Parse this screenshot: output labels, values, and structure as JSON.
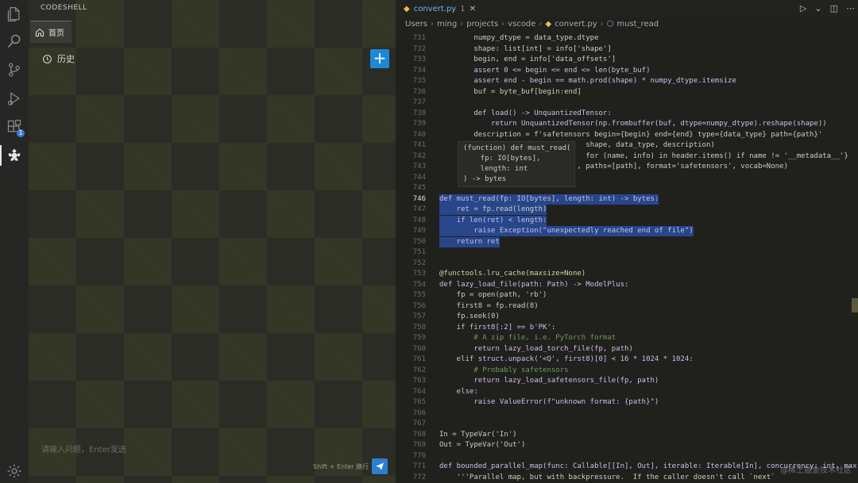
{
  "sidebar_panel": {
    "title": "CODESHELL",
    "home_tab": "首页",
    "history_label": "历史",
    "input_placeholder": "请输入问题，Enter发送",
    "send_hint": "Shift + Enter 换行"
  },
  "activity_bar": {
    "icons": [
      "files-icon",
      "search-icon",
      "source-control-icon",
      "run-debug-icon",
      "extensions-icon",
      "codeshell-icon",
      "gear-icon"
    ],
    "extensions_badge": "1"
  },
  "editor": {
    "tab_name": "convert.py",
    "tab_dirty": "1",
    "breadcrumb": [
      "Users",
      "ming",
      "projects",
      "vscode",
      "convert.py",
      "must_read"
    ],
    "hover_lines": [
      "(function) def must_read(",
      "    fp: IO[bytes],",
      "    length: int",
      ") -> bytes"
    ],
    "lines": [
      {
        "n": "731",
        "t": "        numpy_dtype = data_type.dtype"
      },
      {
        "n": "732",
        "t": "        shape: list[int] = info['shape']"
      },
      {
        "n": "733",
        "t": "        begin, end = info['data_offsets']"
      },
      {
        "n": "734",
        "t": "        assert 0 <= begin <= end <= len(byte_buf)"
      },
      {
        "n": "735",
        "t": "        assert end - begin == math.prod(shape) * numpy_dtype.itemsize"
      },
      {
        "n": "736",
        "t": "        buf = byte_buf[begin:end]"
      },
      {
        "n": "737",
        "t": ""
      },
      {
        "n": "738",
        "t": "        def load() -> UnquantizedTensor:"
      },
      {
        "n": "739",
        "t": "            return UnquantizedTensor(np.frombuffer(buf, dtype=numpy_dtype).reshape(shape))"
      },
      {
        "n": "740",
        "t": "        description = f'safetensors begin={begin} end={end} type={data_type} path={path}'"
      },
      {
        "n": "741",
        "t": "                                  shape, data_type, description)"
      },
      {
        "n": "742",
        "t": "                                  for (name, info) in header.items() if name != '__metadata__'}"
      },
      {
        "n": "743",
        "t": "                                , paths=[path], format='safetensors', vocab=None)"
      },
      {
        "n": "744",
        "t": ""
      },
      {
        "n": "745",
        "t": ""
      },
      {
        "n": "746",
        "t": "def must_read(fp: IO[bytes], length: int) -> bytes:"
      },
      {
        "n": "747",
        "t": "    ret = fp.read(length)"
      },
      {
        "n": "748",
        "t": "    if len(ret) < length:"
      },
      {
        "n": "749",
        "t": "        raise Exception(\"unexpectedly reached end of file\")"
      },
      {
        "n": "750",
        "t": "    return ret"
      },
      {
        "n": "751",
        "t": ""
      },
      {
        "n": "752",
        "t": ""
      },
      {
        "n": "753",
        "t": "@functools.lru_cache(maxsize=None)"
      },
      {
        "n": "754",
        "t": "def lazy_load_file(path: Path) -> ModelPlus:"
      },
      {
        "n": "755",
        "t": "    fp = open(path, 'rb')"
      },
      {
        "n": "756",
        "t": "    first8 = fp.read(8)"
      },
      {
        "n": "757",
        "t": "    fp.seek(0)"
      },
      {
        "n": "758",
        "t": "    if first8[:2] == b'PK':"
      },
      {
        "n": "759",
        "t": "        # A zip file, i.e. PyTorch format"
      },
      {
        "n": "760",
        "t": "        return lazy_load_torch_file(fp, path)"
      },
      {
        "n": "761",
        "t": "    elif struct.unpack('<Q', first8)[0] < 16 * 1024 * 1024:"
      },
      {
        "n": "762",
        "t": "        # Probably safetensors"
      },
      {
        "n": "763",
        "t": "        return lazy_load_safetensors_file(fp, path)"
      },
      {
        "n": "764",
        "t": "    else:"
      },
      {
        "n": "765",
        "t": "        raise ValueError(f\"unknown format: {path}\")"
      },
      {
        "n": "766",
        "t": ""
      },
      {
        "n": "767",
        "t": ""
      },
      {
        "n": "768",
        "t": "In = TypeVar('In')"
      },
      {
        "n": "769",
        "t": "Out = TypeVar('Out')"
      },
      {
        "n": "770",
        "t": ""
      },
      {
        "n": "771",
        "t": "def bounded_parallel_map(func: Callable[[In], Out], iterable: Iterable[In], concurrency: int, max"
      },
      {
        "n": "772",
        "t": "    '''Parallel map, but with backpressure.  If the caller doesn't call `next`"
      }
    ],
    "current_line": "746",
    "selected_lines": [
      "746",
      "747",
      "748",
      "749",
      "750"
    ]
  },
  "watermark": "@稀土掘金技术社区"
}
